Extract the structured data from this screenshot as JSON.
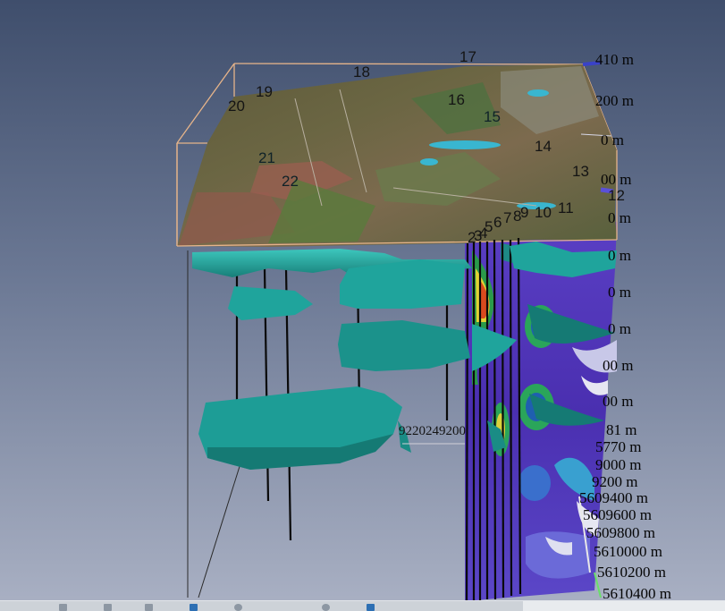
{
  "viewport": {
    "drillholes": [
      {
        "id": "17",
        "label": "17"
      },
      {
        "id": "18",
        "label": "18"
      },
      {
        "id": "19",
        "label": "19"
      },
      {
        "id": "20",
        "label": "20"
      },
      {
        "id": "16",
        "label": "16"
      },
      {
        "id": "15",
        "label": "15"
      },
      {
        "id": "14",
        "label": "14"
      },
      {
        "id": "13",
        "label": "13"
      },
      {
        "id": "12",
        "label": "12"
      },
      {
        "id": "11",
        "label": "11"
      },
      {
        "id": "10",
        "label": "10"
      },
      {
        "id": "9",
        "label": "9"
      },
      {
        "id": "8",
        "label": "8"
      },
      {
        "id": "7",
        "label": "7"
      },
      {
        "id": "6",
        "label": "6"
      },
      {
        "id": "5",
        "label": "5"
      },
      {
        "id": "4",
        "label": "4"
      },
      {
        "id": "3",
        "label": "3"
      },
      {
        "id": "2",
        "label": "2"
      },
      {
        "id": "21",
        "label": "21"
      },
      {
        "id": "22",
        "label": "22"
      }
    ],
    "z_axis": [
      "410 m",
      "200 m",
      "0 m",
      "00 m",
      "0 m",
      "0 m",
      "0 m",
      "0 m",
      "00 m",
      "00 m",
      "00 m"
    ],
    "y_axis": [
      "81 m",
      "5770 m",
      "9000 m",
      "9200 m",
      "5609400 m",
      "5609600 m",
      "5609800 m",
      "5610000 m",
      "5610200 m",
      "5610400 m"
    ],
    "x_axis_text": "9220249200",
    "colors": {
      "sky_top": "#3f4e6c",
      "sky_bottom": "#aab1c4",
      "isosurface": "#1f9a94",
      "isosurface_light": "#33c2b8",
      "section_base": "#4b2fb0",
      "bounding_box": "#e6b48a",
      "axis_marker": "#3a42c8"
    }
  },
  "toolbar": {
    "icons": [
      "toolbar-icon-a",
      "toolbar-icon-b",
      "toolbar-icon-c",
      "toolbar-icon-d",
      "toolbar-icon-e",
      "toolbar-icon-f",
      "toolbar-icon-g"
    ]
  }
}
